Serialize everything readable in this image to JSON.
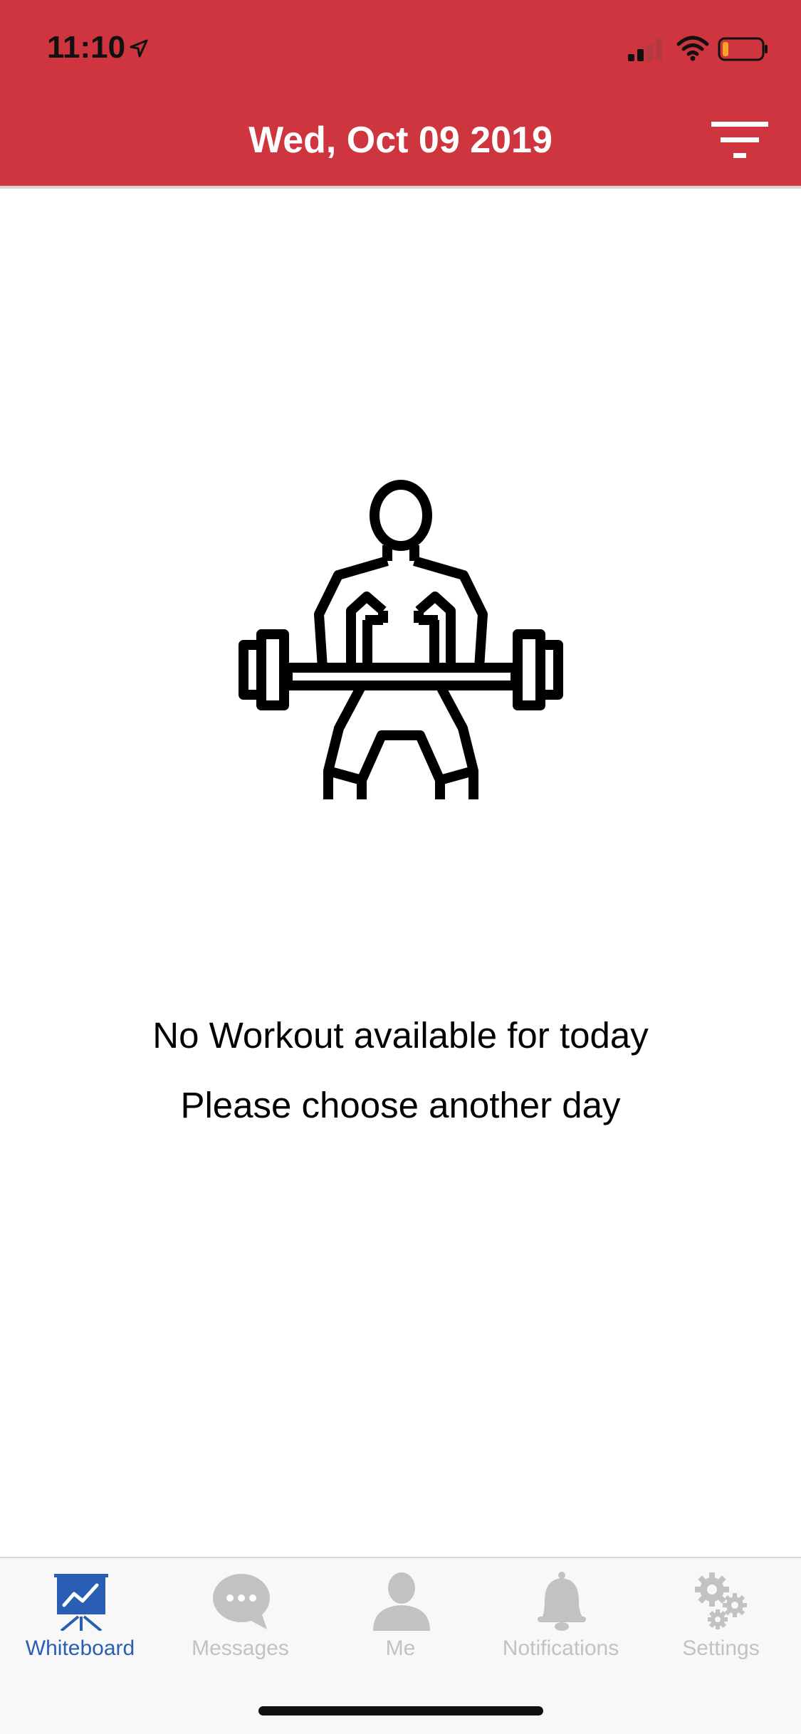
{
  "status_bar": {
    "time": "11:10",
    "location_icon": "location-arrow-icon",
    "signal_icon": "cellular-signal-icon",
    "wifi_icon": "wifi-icon",
    "battery_icon": "battery-low-icon"
  },
  "header": {
    "title": "Wed, Oct 09 2019",
    "background": "#cf353f",
    "filter_icon": "filter-icon"
  },
  "empty_state": {
    "icon": "weightlifter-barbell-icon",
    "line1": "No Workout available for today",
    "line2": "Please choose another day"
  },
  "tabbar": {
    "active_color": "#2a5eb4",
    "inactive_color": "#c2c2c2",
    "tabs": [
      {
        "label": "Whiteboard",
        "icon": "whiteboard-chart-icon",
        "active": true
      },
      {
        "label": "Messages",
        "icon": "chat-bubble-icon",
        "active": false
      },
      {
        "label": "Me",
        "icon": "person-icon",
        "active": false
      },
      {
        "label": "Notifications",
        "icon": "bell-icon",
        "active": false
      },
      {
        "label": "Settings",
        "icon": "gears-icon",
        "active": false
      }
    ]
  }
}
